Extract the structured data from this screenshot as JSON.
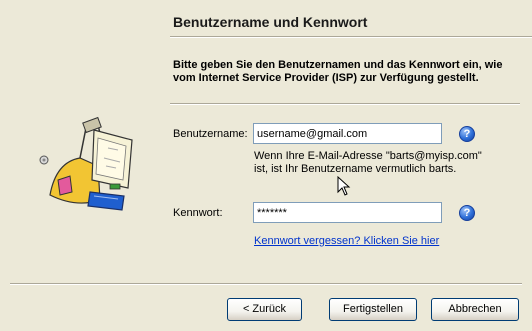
{
  "wizard": {
    "title": "Benutzername und Kennwort",
    "instruction": "Bitte geben Sie den Benutzernamen und das Kennwort ein, wie vom Internet Service Provider (ISP) zur Verfügung gestellt."
  },
  "form": {
    "username_label": "Benutzername:",
    "username_value": "username@gmail.com",
    "hint": "Wenn Ihre E-Mail-Adresse \"barts@myisp.com\" ist, ist Ihr Benutzername vermutlich barts.",
    "password_label": "Kennwort:",
    "password_value": "*******",
    "forgot_link": "Kennwort vergessen? Klicken Sie hier",
    "help_glyph": "?"
  },
  "buttons": {
    "back": "< Zurück",
    "finish": "Fertigstellen",
    "cancel": "Abbrechen"
  },
  "icons": {
    "help": "help-icon",
    "illustration": "computer-illustration",
    "cursor": "arrow-cursor"
  }
}
